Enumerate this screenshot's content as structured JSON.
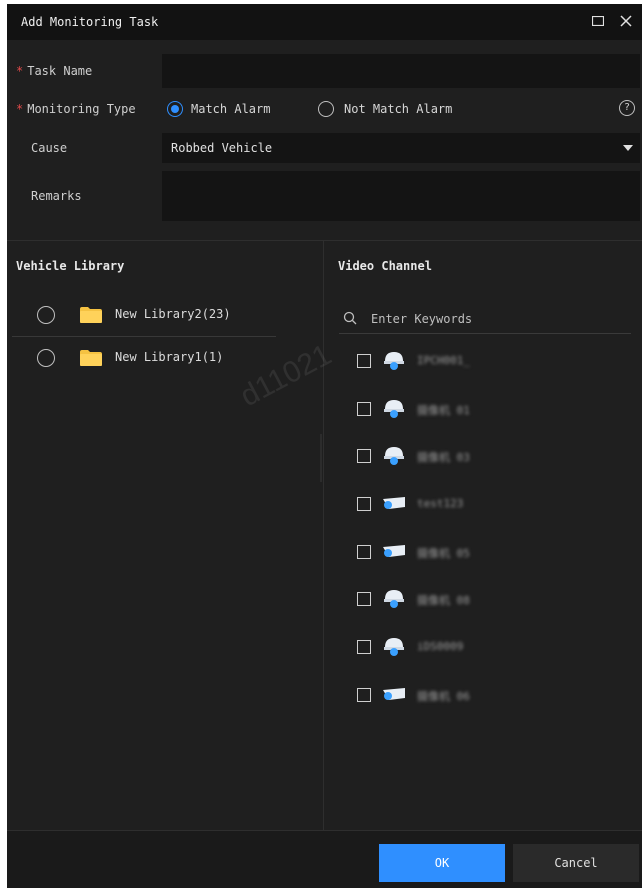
{
  "dialog": {
    "title": "Add Monitoring Task",
    "icons": {
      "maximize": "maximize-icon",
      "close": "close-icon"
    }
  },
  "form": {
    "required_mark": "*",
    "task_name_label": "Task Name",
    "task_name_value": "",
    "monitoring_type_label": "Monitoring Type",
    "match_alarm_label": "Match Alarm",
    "not_match_alarm_label": "Not Match Alarm",
    "monitoring_type_selected": "Match Alarm",
    "cause_label": "Cause",
    "cause_value": "Robbed Vehicle",
    "remarks_label": "Remarks",
    "remarks_value": "",
    "help_glyph": "?"
  },
  "vehicle_library": {
    "title": "Vehicle Library",
    "items": [
      {
        "label": "New Library2(23)"
      },
      {
        "label": "New Library1(1)"
      }
    ]
  },
  "video_channel": {
    "title": "Video Channel",
    "search_placeholder": "Enter Keywords",
    "channels": [
      {
        "name": "IPCH001_",
        "icon": "dome-camera-icon"
      },
      {
        "name": "摄像机 01",
        "icon": "dome-camera-icon"
      },
      {
        "name": "摄像机 03",
        "icon": "dome-camera-icon"
      },
      {
        "name": "test123",
        "icon": "bullet-camera-icon"
      },
      {
        "name": "摄像机 05",
        "icon": "bullet-camera-icon"
      },
      {
        "name": "摄像机 08",
        "icon": "dome-camera-icon"
      },
      {
        "name": "iDS0009",
        "icon": "dome-camera-icon"
      },
      {
        "name": "摄像机 06",
        "icon": "bullet-camera-icon"
      }
    ]
  },
  "footer": {
    "ok_label": "OK",
    "cancel_label": "Cancel"
  },
  "watermark": "d11021",
  "colors": {
    "accent": "#2f8fff",
    "required": "#e34b4b",
    "background": "#1f1f1f",
    "folder": "#f5c242"
  }
}
